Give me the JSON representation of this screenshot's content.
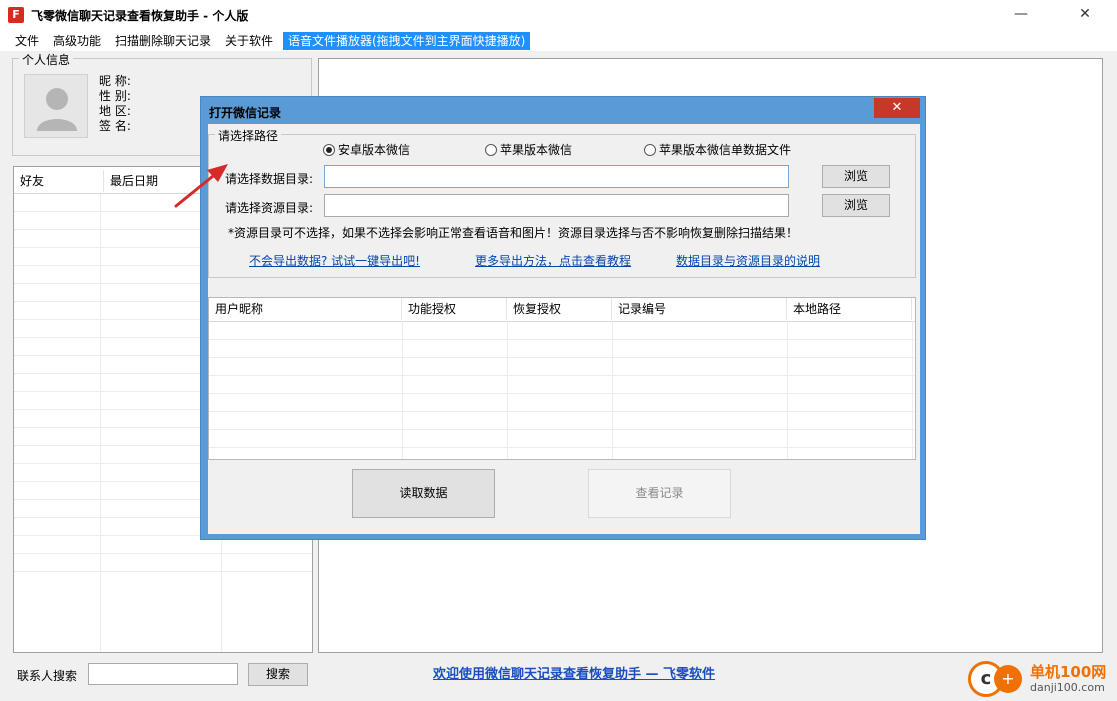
{
  "window": {
    "title": "飞零微信聊天记录查看恢复助手 - 个人版",
    "icon_glyph": "F",
    "minimize_glyph": "—",
    "close_glyph": "✕"
  },
  "menu": [
    "文件",
    "高级功能",
    "扫描删除聊天记录",
    "关于软件",
    "语音文件播放器(拖拽文件到主界面快捷播放)"
  ],
  "personal_info": {
    "legend": "个人信息",
    "fields": [
      "昵 称:",
      "性 别:",
      "地 区:",
      "签 名:"
    ]
  },
  "friends_table": {
    "columns": [
      "好友",
      "最后日期"
    ]
  },
  "bottom": {
    "search_label": "联系人搜索",
    "search_value": "",
    "search_button": "搜索",
    "welcome_link": "欢迎使用微信聊天记录查看恢复助手 — 飞零软件"
  },
  "watermark": {
    "text": "单机100网",
    "url": "danji100.com"
  },
  "dialog": {
    "title": "打开微信记录",
    "close_glyph": "✕",
    "path_group_legend": "请选择路径",
    "radios": [
      {
        "label": "安卓版本微信",
        "checked": true
      },
      {
        "label": "苹果版本微信",
        "checked": false
      },
      {
        "label": "苹果版本微信单数据文件",
        "checked": false
      }
    ],
    "data_dir_label": "请选择数据目录:",
    "data_dir_value": "",
    "resource_dir_label": "请选择资源目录:",
    "resource_dir_value": "",
    "browse_label": "浏览",
    "note": "*资源目录可不选择，如果不选择会影响正常查看语音和图片！资源目录选择与否不影响恢复删除扫描结果！",
    "links": [
      "不会导出数据? 试试一键导出吧!",
      "更多导出方法，点击查看教程",
      "数据目录与资源目录的说明"
    ],
    "table_columns": [
      "用户昵称",
      "功能授权",
      "恢复授权",
      "记录编号",
      "本地路径"
    ],
    "read_button": "读取数据",
    "view_button": "查看记录",
    "view_button_enabled": false
  },
  "colors": {
    "accent": "#1e90ff",
    "dialog_border": "#5b9bd5",
    "close_red": "#c7382b",
    "link": "#0645ad",
    "arrow": "#d42a2a",
    "brand_orange": "#f07000"
  }
}
